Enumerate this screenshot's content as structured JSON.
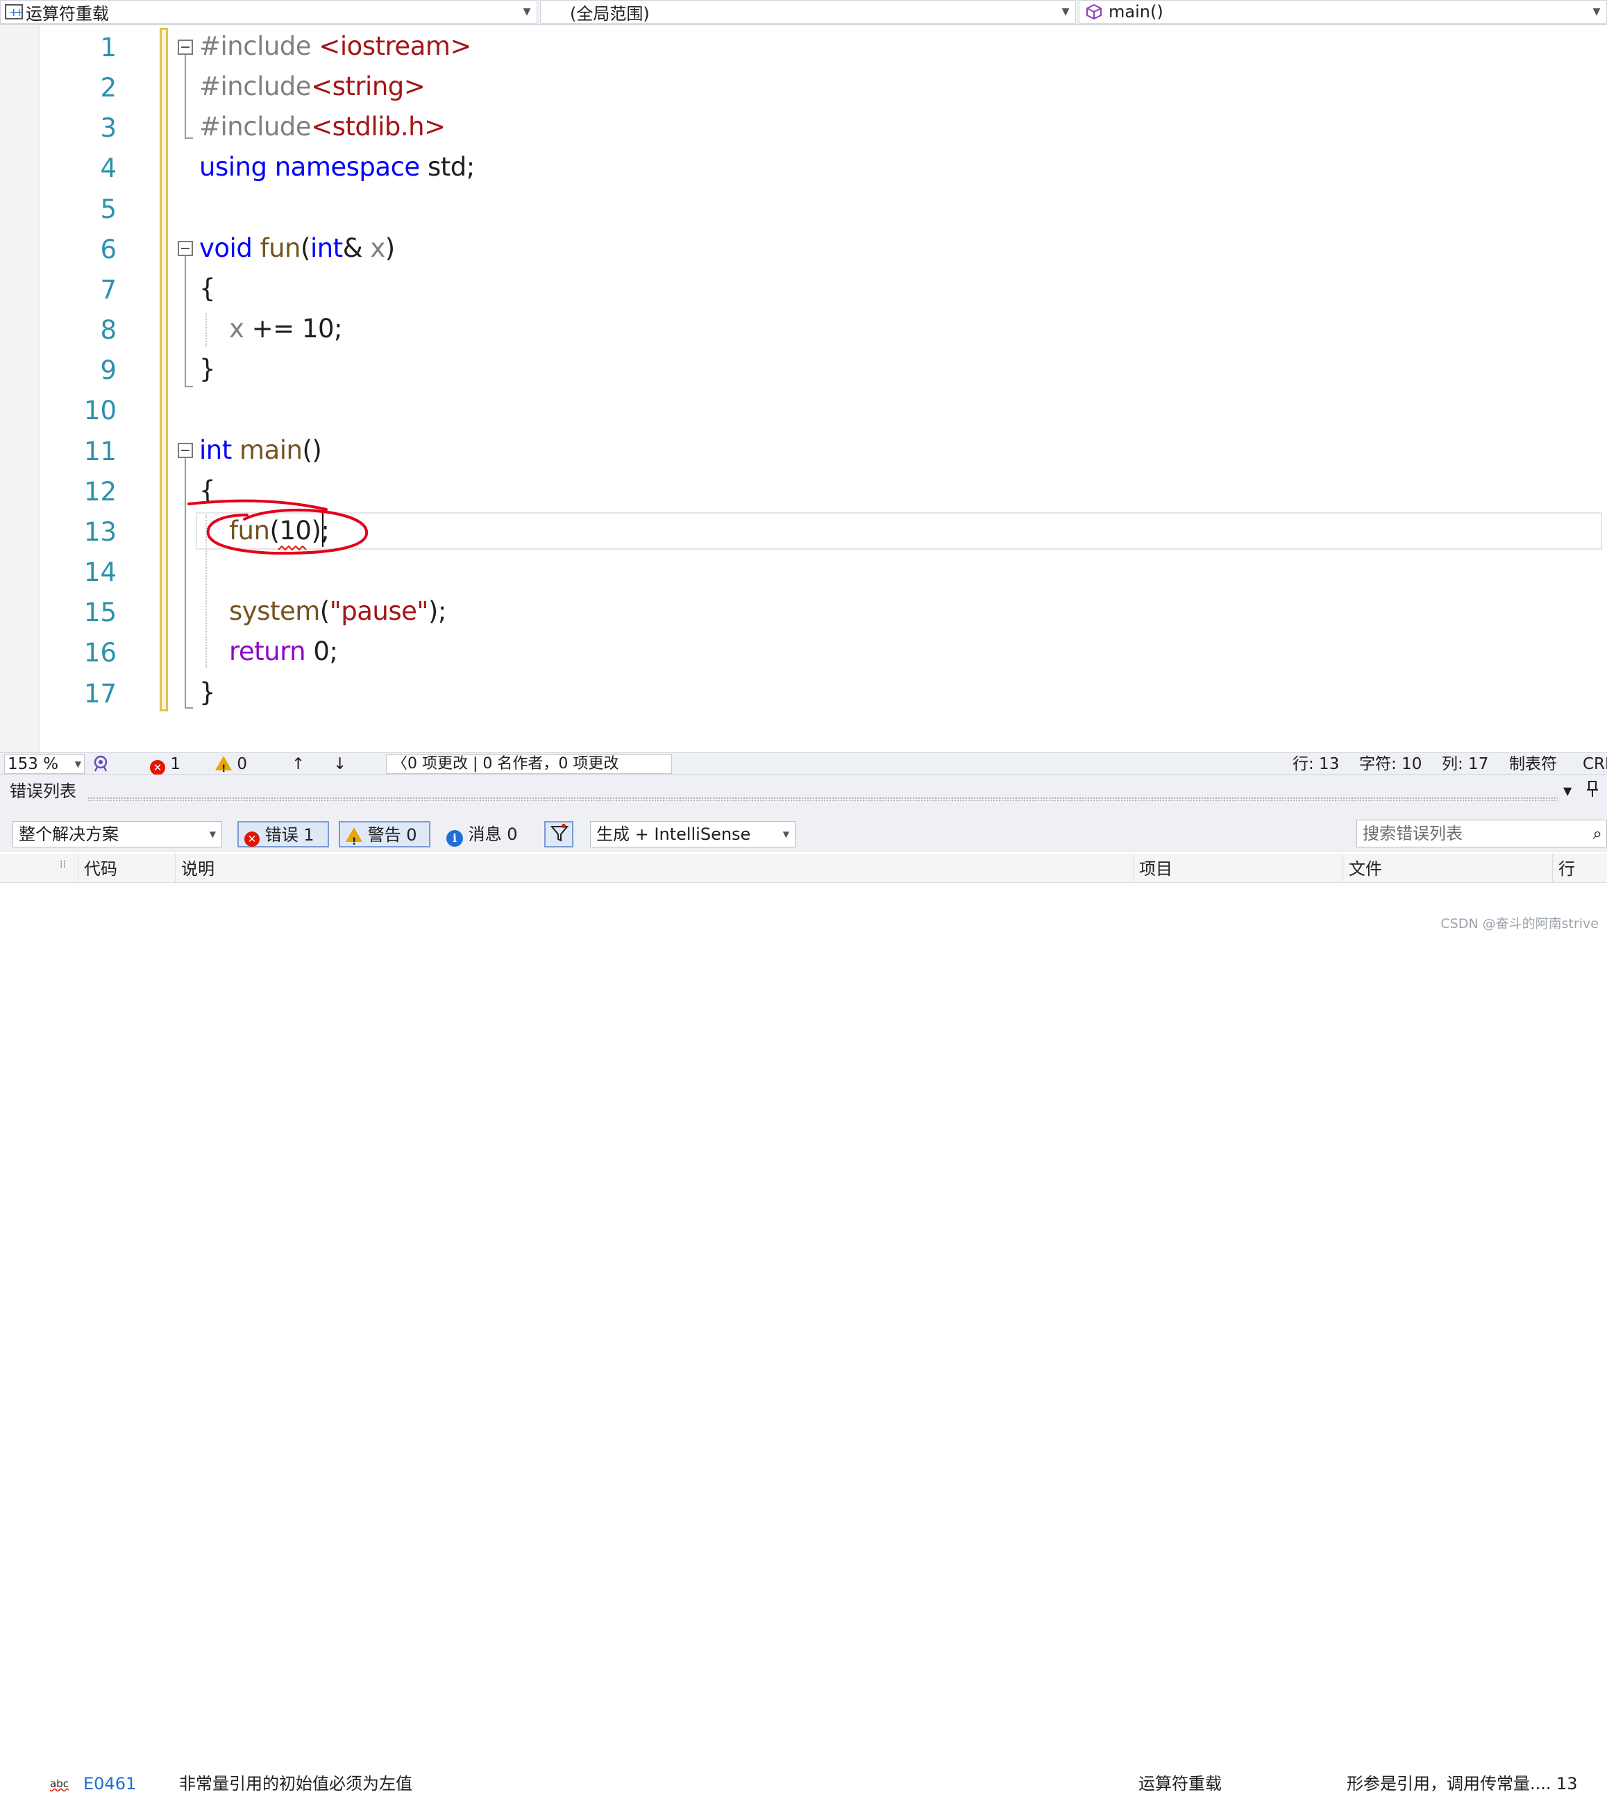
{
  "nav": {
    "project": "运算符重载",
    "scope": "(全局范围)",
    "member": "main()"
  },
  "editor": {
    "line_numbers": [
      "1",
      "2",
      "3",
      "4",
      "5",
      "6",
      "7",
      "8",
      "9",
      "10",
      "11",
      "12",
      "13",
      "14",
      "15",
      "16",
      "17"
    ],
    "code": {
      "l1_pp": "#include ",
      "l1_inc": "<iostream>",
      "l2_pp": "#include",
      "l2_inc": "<string>",
      "l3_pp": "#include",
      "l3_inc": "<stdlib.h>",
      "l4_kw": "using namespace",
      "l4_rest": " std;",
      "l6_kw": "void",
      "l6_fn": " fun",
      "l6_p1": "(",
      "l6_kw2": "int",
      "l6_p2": "& ",
      "l6_prm": "x",
      "l6_p3": ")",
      "l7": "{",
      "l8_prm": "x",
      "l8_rest": " += 10;",
      "l9": "}",
      "l11_kw": "int",
      "l11_fn": " main",
      "l11_rest": "()",
      "l12": "{",
      "l13_fn": "fun",
      "l13_rest": "(10);",
      "l15_fn": "system",
      "l15_p1": "(",
      "l15_str": "\"pause\"",
      "l15_p2": ");",
      "l16_kw": "return",
      "l16_rest": " 0;",
      "l17": "}"
    }
  },
  "status": {
    "zoom": "153 %",
    "errors": "1",
    "warnings": "0",
    "changes": "0 项更改 | 0 名作者，0 项更改",
    "line": "行: 13",
    "char": "字符: 10",
    "col": "列: 17",
    "tabs": "制表符",
    "eol": "CRL"
  },
  "error_list": {
    "title": "错误列表",
    "scope": "整个解决方案",
    "errors_btn": "错误 1",
    "warnings_btn": "警告 0",
    "messages_btn": "消息 0",
    "build": "生成 + IntelliSense",
    "search_placeholder": "搜索错误列表",
    "columns": {
      "code": "代码",
      "desc": "说明",
      "project": "项目",
      "file": "文件",
      "line": "行"
    },
    "rows": [
      {
        "code": "E0461",
        "desc": "非常量引用的初始值必须为左值",
        "project": "运算符重载",
        "file": "形参是引用，调用传常量....",
        "line": "13"
      }
    ]
  },
  "watermark": "CSDN @奋斗的阿南strive",
  "colors": {
    "keyword": "#0000ff",
    "function": "#74531f",
    "string": "#a31515",
    "line_number": "#2b91af",
    "annotation": "#e4001b",
    "change_bar": "#e2c34a"
  }
}
